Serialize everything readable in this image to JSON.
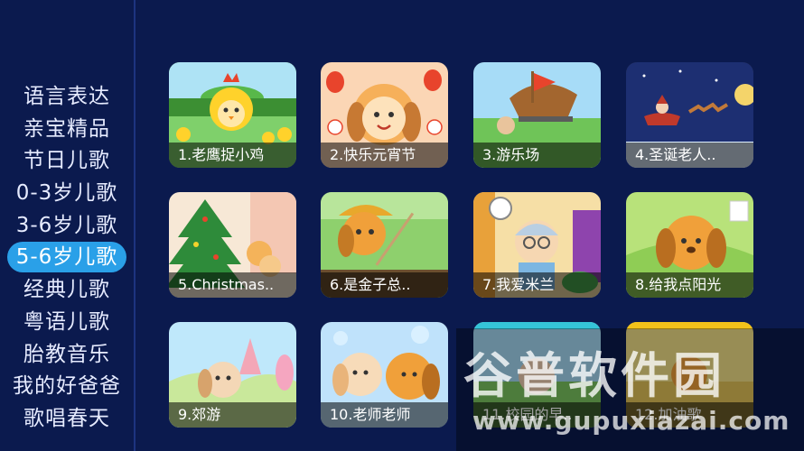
{
  "sidebar": {
    "items": [
      {
        "label": "语言表达"
      },
      {
        "label": "亲宝精品"
      },
      {
        "label": "节日儿歌"
      },
      {
        "label": "0-3岁儿歌"
      },
      {
        "label": "3-6岁儿歌"
      },
      {
        "label": "5-6岁儿歌",
        "selected": true
      },
      {
        "label": "经典儿歌"
      },
      {
        "label": "粤语儿歌"
      },
      {
        "label": "胎教音乐"
      },
      {
        "label": "我的好爸爸"
      },
      {
        "label": "歌唱春天"
      }
    ]
  },
  "songs": [
    {
      "title": "1.老鹰捉小鸡"
    },
    {
      "title": "2.快乐元宵节"
    },
    {
      "title": "3.游乐场"
    },
    {
      "title": "4.圣诞老人.."
    },
    {
      "title": "5.Christmas.."
    },
    {
      "title": "6.是金子总.."
    },
    {
      "title": "7.我爱米兰"
    },
    {
      "title": "8.给我点阳光"
    },
    {
      "title": "9.郊游"
    },
    {
      "title": "10.老师老师"
    },
    {
      "title": "11.校园的早.."
    },
    {
      "title": "12.加油歌"
    }
  ],
  "watermark": {
    "logo_text": "谷普软件园",
    "url": "www.gupuxiazai.com"
  },
  "colors": {
    "background": "#0b1a4e",
    "accent": "#2aa0e8"
  }
}
